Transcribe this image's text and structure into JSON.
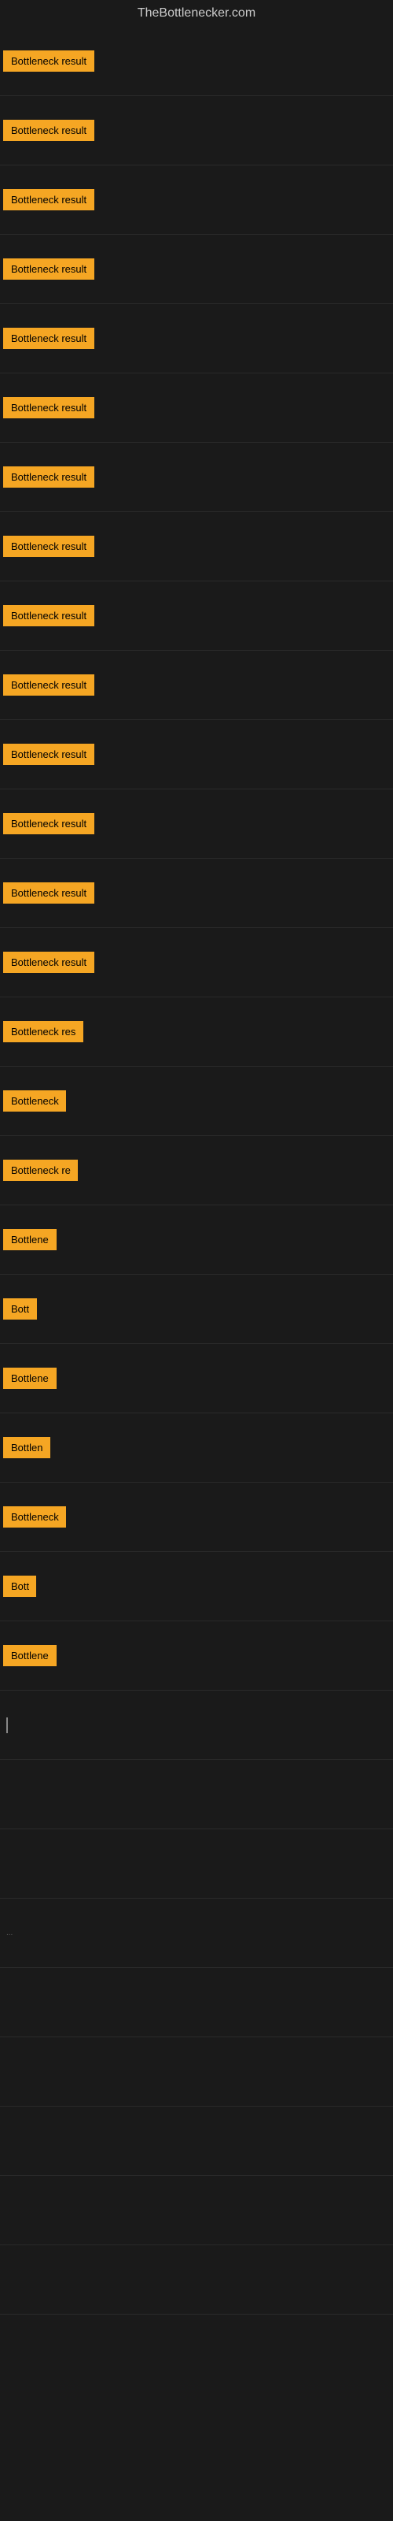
{
  "site": {
    "title": "TheBottlenecker.com"
  },
  "rows": [
    {
      "label": "Bottleneck result",
      "width": 130
    },
    {
      "label": "Bottleneck result",
      "width": 130
    },
    {
      "label": "Bottleneck result",
      "width": 130
    },
    {
      "label": "Bottleneck result",
      "width": 130
    },
    {
      "label": "Bottleneck result",
      "width": 130
    },
    {
      "label": "Bottleneck result",
      "width": 130
    },
    {
      "label": "Bottleneck result",
      "width": 130
    },
    {
      "label": "Bottleneck result",
      "width": 130
    },
    {
      "label": "Bottleneck result",
      "width": 130
    },
    {
      "label": "Bottleneck result",
      "width": 130
    },
    {
      "label": "Bottleneck result",
      "width": 130
    },
    {
      "label": "Bottleneck result",
      "width": 130
    },
    {
      "label": "Bottleneck result",
      "width": 130
    },
    {
      "label": "Bottleneck result",
      "width": 130
    },
    {
      "label": "Bottleneck res",
      "width": 110
    },
    {
      "label": "Bottleneck",
      "width": 80
    },
    {
      "label": "Bottleneck re",
      "width": 95
    },
    {
      "label": "Bottlene",
      "width": 70
    },
    {
      "label": "Bott",
      "width": 45
    },
    {
      "label": "Bottlene",
      "width": 70
    },
    {
      "label": "Bottlen",
      "width": 65
    },
    {
      "label": "Bottleneck",
      "width": 80
    },
    {
      "label": "Bott",
      "width": 42
    },
    {
      "label": "Bottlene",
      "width": 70
    }
  ],
  "extra_items": [
    {
      "label": "|",
      "type": "cursor"
    },
    {
      "label": "",
      "type": "empty"
    },
    {
      "label": "",
      "type": "empty"
    },
    {
      "label": "...",
      "type": "small"
    },
    {
      "label": "",
      "type": "empty"
    },
    {
      "label": "",
      "type": "empty"
    },
    {
      "label": "",
      "type": "empty"
    },
    {
      "label": "",
      "type": "empty"
    },
    {
      "label": "",
      "type": "empty"
    }
  ],
  "badge_color": "#f5a623"
}
